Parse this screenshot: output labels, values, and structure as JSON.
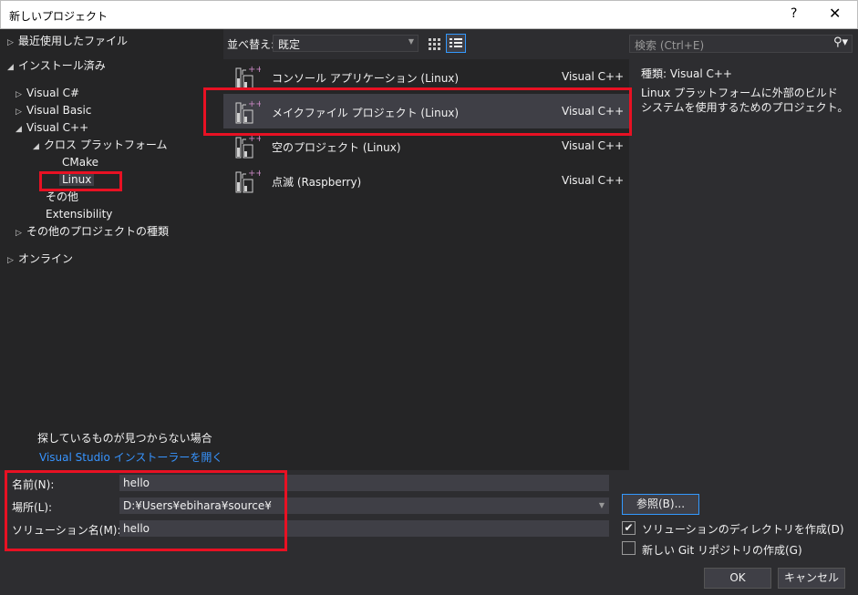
{
  "window": {
    "title": "新しいプロジェクト",
    "help": "?",
    "close": "✕"
  },
  "tree": {
    "recent": "最近使用したファイル",
    "installed": "インストール済み",
    "visual_csharp": "Visual C#",
    "visual_basic": "Visual Basic",
    "visual_cpp": "Visual C++",
    "cross_platform": "クロス プラットフォーム",
    "cmake": "CMake",
    "linux": "Linux",
    "other": "その他",
    "extensibility": "Extensibility",
    "other_project_types": "その他のプロジェクトの種類",
    "online": "オンライン"
  },
  "hint": {
    "text": "探しているものが見つからない場合",
    "link": "Visual Studio インストーラーを開く"
  },
  "toolbar": {
    "sort_label": "並べ替え:",
    "sort_value": "既定"
  },
  "search": {
    "placeholder": "検索 (Ctrl+E)"
  },
  "templates": [
    {
      "name": "コンソール アプリケーション (Linux)",
      "lang": "Visual C++"
    },
    {
      "name": "メイクファイル プロジェクト (Linux)",
      "lang": "Visual C++"
    },
    {
      "name": "空のプロジェクト (Linux)",
      "lang": "Visual C++"
    },
    {
      "name": "点滅 (Raspberry)",
      "lang": "Visual C++"
    }
  ],
  "details": {
    "type_label": "種類:  Visual C++",
    "description": "Linux プラットフォームに外部のビルド システムを使用するためのプロジェクト。"
  },
  "form": {
    "name_label": "名前(N):",
    "name_value": "hello",
    "location_label": "場所(L):",
    "location_value": "D:¥Users¥ebihara¥source¥",
    "solution_label": "ソリューション名(M):",
    "solution_value": "hello",
    "browse": "参照(B)...",
    "create_dir": "ソリューションのディレクトリを作成(D)",
    "create_dir_checked": true,
    "git": "新しい Git リポジトリの作成(G)",
    "git_checked": false,
    "ok": "OK",
    "cancel": "キャンセル"
  },
  "colors": {
    "accent": "#3399ff",
    "highlight_box": "#e81123",
    "icon_plus": "#c586c0"
  }
}
